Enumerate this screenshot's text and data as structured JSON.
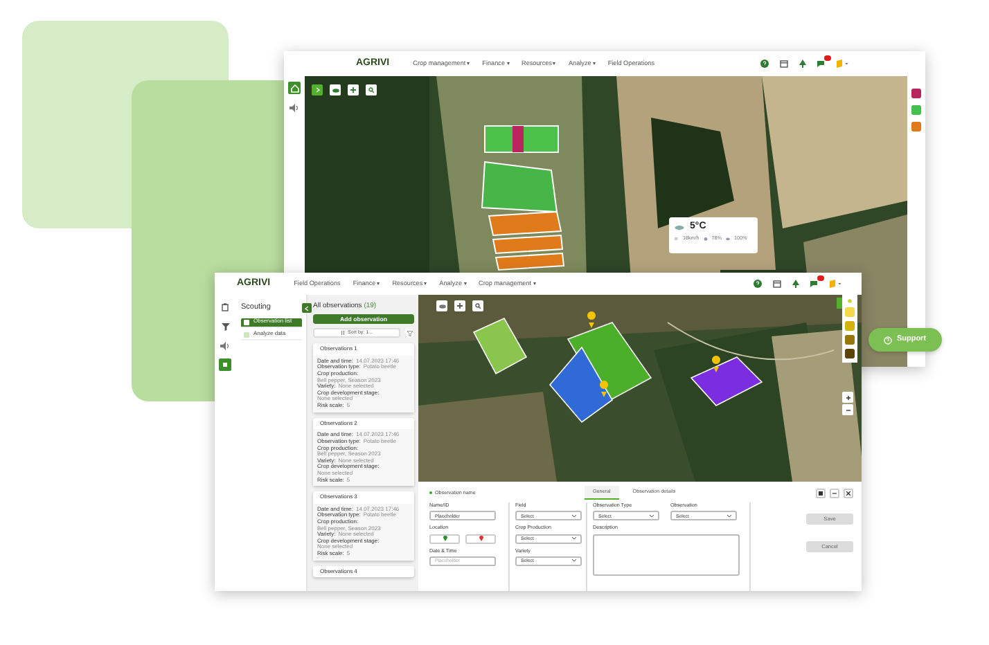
{
  "back_window": {
    "logo": "AGRIVI",
    "menu": [
      {
        "label": "Crop management",
        "dropdown": true
      },
      {
        "label": "Finance",
        "dropdown": true
      },
      {
        "label": "Resources",
        "dropdown": true
      },
      {
        "label": "Analyze",
        "dropdown": true
      },
      {
        "label": "Field Operations",
        "dropdown": false
      }
    ],
    "weather": {
      "temperature": "5°C",
      "wind": "18km/h",
      "humidity": "78%",
      "clouds": "100%"
    },
    "legend": [
      {
        "color": "#b8245e"
      },
      {
        "color": "#45c04f"
      },
      {
        "color": "#e27a1a"
      }
    ]
  },
  "front_window": {
    "logo": "AGRIVI",
    "menu": [
      {
        "label": "Field Operations",
        "dropdown": false
      },
      {
        "label": "Finance",
        "dropdown": true
      },
      {
        "label": "Resources",
        "dropdown": true
      },
      {
        "label": "Analyze",
        "dropdown": true
      },
      {
        "label": "Crop management",
        "dropdown": true
      }
    ],
    "sidebar": {
      "title": "Scouting",
      "items": [
        {
          "label": "Observation list",
          "selected": true
        },
        {
          "label": "Analyze data",
          "selected": false
        }
      ]
    },
    "observations": {
      "title": "All observations",
      "count": "(19)",
      "add_button": "Add observation",
      "sort": "Sort by: 1...",
      "cards": [
        {
          "title": "Observations 1",
          "details": [
            {
              "label": "Date and time:",
              "value": "14.07.2023 17:46"
            },
            {
              "label": "Observation type:",
              "value": "Potato beetle"
            },
            {
              "label": "Crop production:",
              "value": "Bell pepper, Season 2023"
            },
            {
              "label": "Variety:",
              "value": "None selected"
            },
            {
              "label": "Crop development stage:",
              "value": "None selected"
            },
            {
              "label": "Risk scale:",
              "value": "5"
            }
          ]
        },
        {
          "title": "Observations 2",
          "details": [
            {
              "label": "Date and time:",
              "value": "14.07.2023 17:46"
            },
            {
              "label": "Observation type:",
              "value": "Potato beetle"
            },
            {
              "label": "Crop production:",
              "value": "Bell pepper, Season 2023"
            },
            {
              "label": "Variety:",
              "value": "None selected"
            },
            {
              "label": "Crop development stage:",
              "value": "None selected"
            },
            {
              "label": "Risk scale:",
              "value": "5"
            }
          ]
        },
        {
          "title": "Observations 3",
          "details": [
            {
              "label": "Date and time:",
              "value": "14.07.2023 17:46"
            },
            {
              "label": "Observation type:",
              "value": "Potato beetle"
            },
            {
              "label": "Crop production:",
              "value": "Bell pepper, Season 2023"
            },
            {
              "label": "Variety:",
              "value": "None selected"
            },
            {
              "label": "Crop development stage:",
              "value": "None selected"
            },
            {
              "label": "Risk scale:",
              "value": "5"
            }
          ]
        },
        {
          "title": "Observations 4"
        }
      ]
    },
    "legend": [
      {
        "color": "#f6d94a"
      },
      {
        "color": "#d3b20c"
      },
      {
        "color": "#98760c"
      },
      {
        "color": "#5b4408"
      }
    ],
    "form": {
      "title": "Observation name",
      "tabs": [
        {
          "label": "General",
          "selected": true
        },
        {
          "label": "Observation details",
          "selected": false
        }
      ],
      "columns": [
        [
          {
            "kind": "input",
            "label": "Name/ID",
            "value": "Placeholder"
          },
          {
            "kind": "location",
            "label": "Location"
          },
          {
            "kind": "input",
            "label": "Date & Time",
            "placeholder": "Placeholder"
          }
        ],
        [
          {
            "kind": "select",
            "label": "Field",
            "value": "Select"
          },
          {
            "kind": "select",
            "label": "Crop Production",
            "value": "Select"
          },
          {
            "kind": "select",
            "label": "Variety",
            "value": "Select"
          }
        ],
        [
          {
            "kind": "select",
            "label": "Observation Type",
            "value": "Select"
          },
          {
            "kind": "select",
            "label": "Observation",
            "value": "Select"
          },
          {
            "kind": "textarea",
            "label": "Description"
          }
        ]
      ],
      "buttons": [
        {
          "label": "Save",
          "disabled": true
        },
        {
          "label": "Cancel",
          "disabled": true
        }
      ]
    }
  },
  "support_button": "Support"
}
